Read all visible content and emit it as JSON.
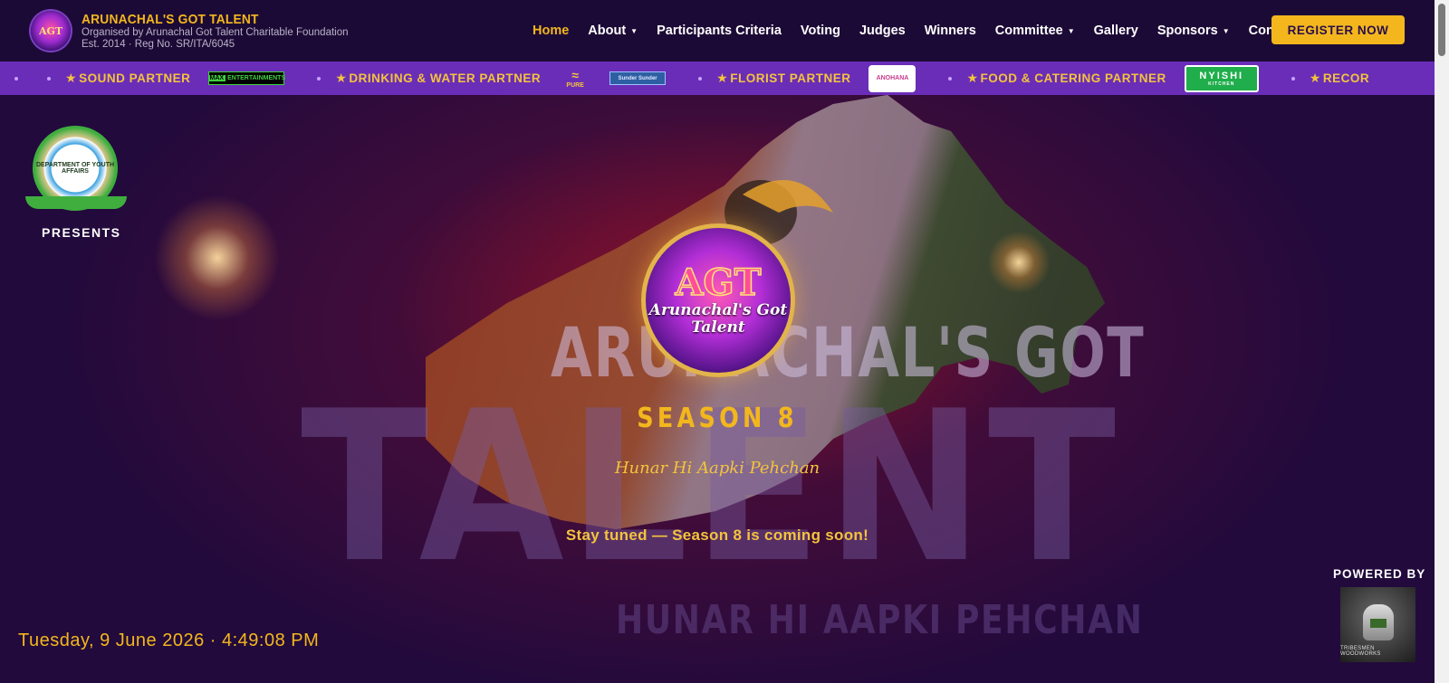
{
  "site": {
    "title": "ARUNACHAL'S GOT TALENT",
    "subtitle": "Organised by Arunachal Got Talent Charitable Foundation",
    "established": "Est. 2014 · Reg No. SR/ITA/6045"
  },
  "nav": {
    "items": [
      {
        "label": "Home",
        "active": true,
        "dropdown": false
      },
      {
        "label": "About",
        "active": false,
        "dropdown": true
      },
      {
        "label": "Participants Criteria",
        "active": false,
        "dropdown": false
      },
      {
        "label": "Voting",
        "active": false,
        "dropdown": false
      },
      {
        "label": "Judges",
        "active": false,
        "dropdown": false
      },
      {
        "label": "Winners",
        "active": false,
        "dropdown": false
      },
      {
        "label": "Committee",
        "active": false,
        "dropdown": true
      },
      {
        "label": "Gallery",
        "active": false,
        "dropdown": false
      },
      {
        "label": "Sponsors",
        "active": false,
        "dropdown": true
      },
      {
        "label": "Contact",
        "active": false,
        "dropdown": false
      }
    ],
    "register_label": "REGISTER NOW"
  },
  "ticker": {
    "sound_partner": "SOUND PARTNER",
    "max_logo_mark": "MAX",
    "max_logo_text": "ENTERTAINMENTS",
    "drinking_partner": "DRINKING & WATER PARTNER",
    "fm_logo_text": "PURE",
    "blue_logo_text": "Sunder Sunder",
    "florist_partner": "FLORIST PARTNER",
    "ano_logo_text": "ANOHANA",
    "food_partner": "FOOD & CATERING PARTNER",
    "nyishi_logo_text": "NYISHI",
    "nyishi_logo_sub": "KITCHEN",
    "cut_label": "RECOR"
  },
  "hero": {
    "background_words": {
      "line1": "ARUNACHAL'S GOT",
      "line2": "TALENT",
      "line3": "HUNAR HI AAPKI PEHCHAN"
    },
    "emblem_text": "DEPARTMENT OF YOUTH AFFAIRS",
    "presents": "PRESENTS",
    "logo_short": "AGT",
    "logo_full": "Arunachal's Got Talent",
    "season": "SEASON 8",
    "tagline": "Hunar Hi Aapki Pehchan",
    "status": "Stay tuned — Season 8 is coming soon!",
    "datetime": "Tuesday, 9 June 2026 · 4:49:08 PM",
    "powered_by": "POWERED BY",
    "powered_name": "TRIBESMEN WOODWORKS"
  },
  "colors": {
    "accent": "#f3b71d",
    "header_bg": "#1c0a36",
    "ticker_bg": "#6a2db8"
  }
}
